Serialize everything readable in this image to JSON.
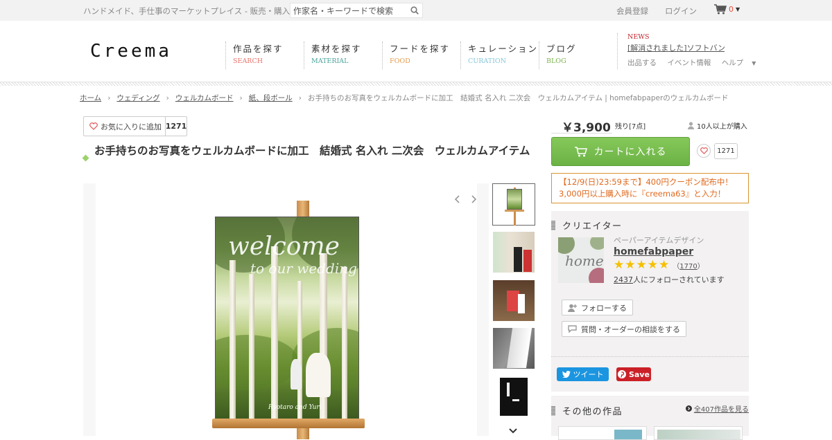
{
  "topbar": {
    "tagline": "ハンドメイド、手仕事のマーケットプレイス - 販売・購入",
    "search_placeholder": "作家名・キーワードで検索",
    "register": "会員登録",
    "login": "ログイン",
    "cart_count": "0"
  },
  "header": {
    "logo": "Creema",
    "nav": [
      {
        "ja": "作品を探す",
        "en": "SEARCH",
        "color": "#e8736c"
      },
      {
        "ja": "素材を探す",
        "en": "MATERIAL",
        "color": "#4aa39a"
      },
      {
        "ja": "フードを探す",
        "en": "FOOD",
        "color": "#e59a4c"
      },
      {
        "ja": "キュレーション",
        "en": "CURATION",
        "color": "#84c6d9"
      },
      {
        "ja": "ブログ",
        "en": "BLOG",
        "color": "#7ab24a"
      }
    ],
    "news_label": "NEWS",
    "news_text": "[解消されました]ソフトバンク…",
    "links": {
      "sell": "出品する",
      "events": "イベント情報",
      "help": "ヘルプ"
    }
  },
  "breadcrumb": {
    "items": [
      "ホーム",
      "ウェディング",
      "ウェルカムボード",
      "紙、段ボール"
    ],
    "current": "お手持ちのお写真をウェルカムボードに加工　結婚式 名入れ 二次会　ウェルカムアイテム | homefabpaperのウェルカムボード"
  },
  "product": {
    "fav_label": "お気に入りに追加",
    "fav_count": "1271",
    "title": "お手持ちのお写真をウェルカムボードに加工　結婚式 名入れ 二次会　ウェルカムアイテム",
    "image_text_1": "welcome",
    "image_text_2": "to our wedding",
    "image_names": "Ryotaro and Yuri"
  },
  "purchase": {
    "price": "￥3,900",
    "stock": "残り[7点]",
    "buyers": "10人以上が購入",
    "cart_button": "カートに入れる",
    "fav_count": "1271",
    "coupon_line1": "【12/9(日)23:59まで】400円クーポン配布中！",
    "coupon_line2": "3,000円以上購入時に『creema63』と入力！"
  },
  "creator": {
    "heading": "クリエイター",
    "category": "ペーパーアイテムデザイン",
    "name": "homefabpaper",
    "rating": 5,
    "review_count": "1770",
    "followers": "2437",
    "followers_suffix": "人にフォローされています",
    "avatar_text": "home",
    "follow_button": "フォローする",
    "consult_button": "質問・オーダーの相談をする"
  },
  "share": {
    "tweet": "ツイート",
    "pin": "Save"
  },
  "other_works": {
    "heading": "その他の作品",
    "see_all": "全407作品を見る"
  }
}
